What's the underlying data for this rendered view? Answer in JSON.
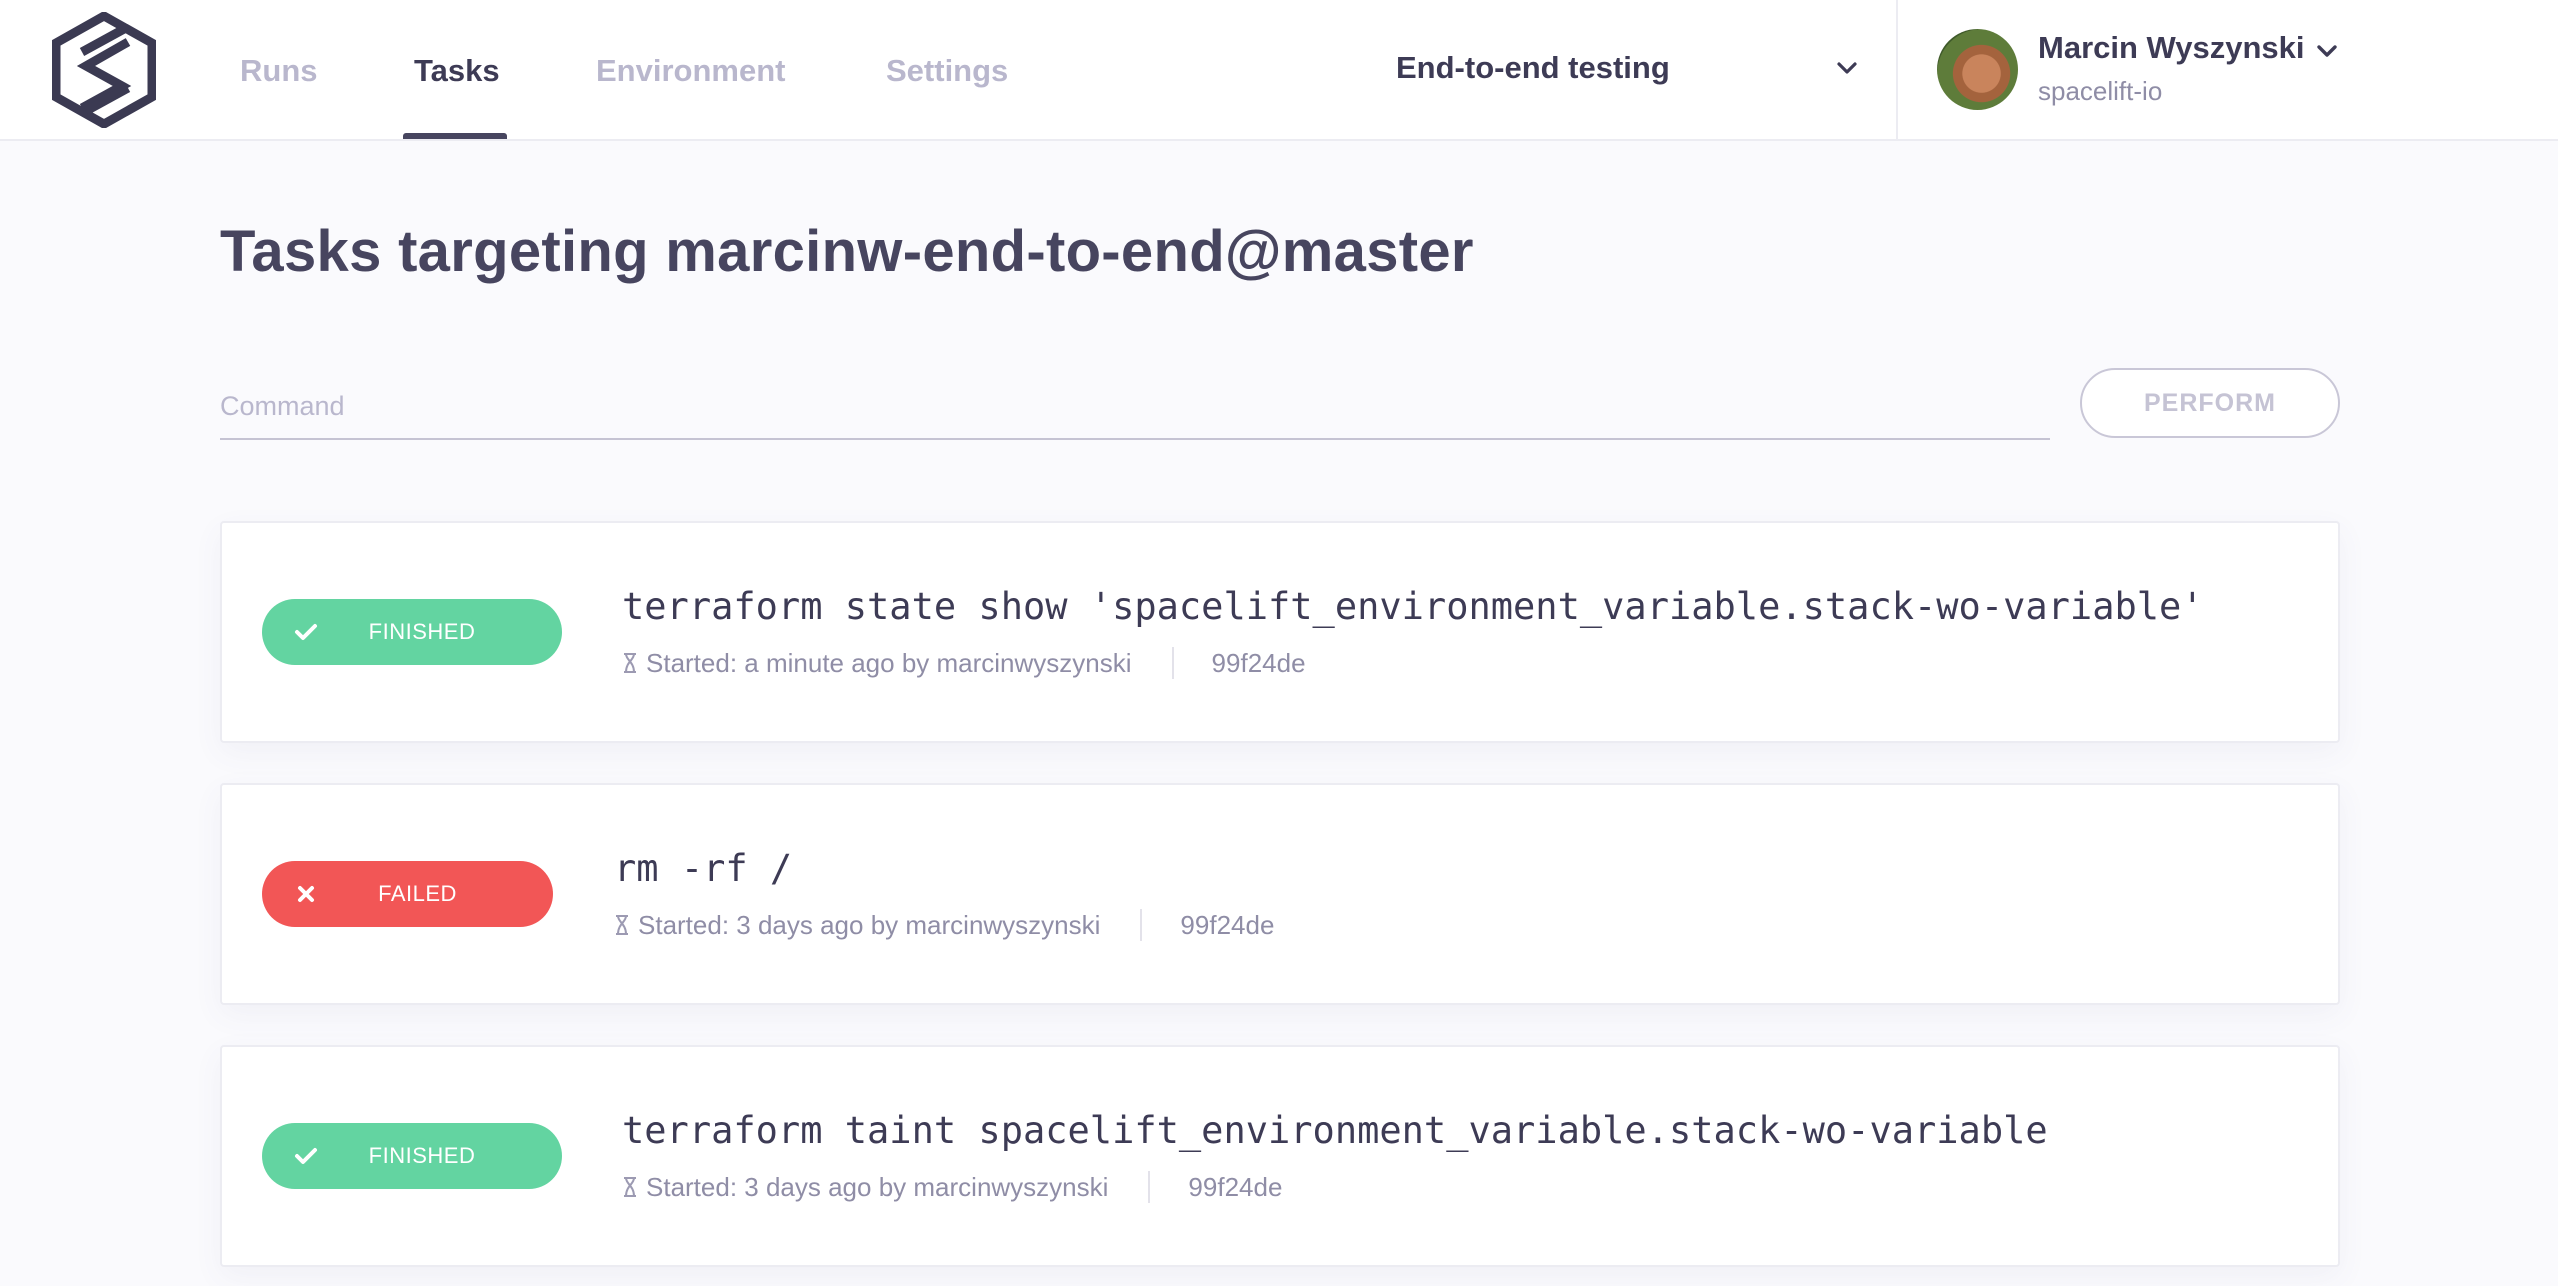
{
  "nav": {
    "tabs": [
      {
        "label": "Runs"
      },
      {
        "label": "Tasks"
      },
      {
        "label": "Environment"
      },
      {
        "label": "Settings"
      }
    ],
    "active_tab": "Tasks"
  },
  "stack_selector": {
    "label": "End-to-end testing"
  },
  "user": {
    "name": "Marcin Wyszynski",
    "org": "spacelift-io"
  },
  "page": {
    "title": "Tasks targeting marcinw-end-to-end@master"
  },
  "command_form": {
    "placeholder": "Command",
    "perform_label": "PERFORM"
  },
  "tasks": [
    {
      "status": "FINISHED",
      "command": "terraform state show 'spacelift_environment_variable.stack-wo-variable'",
      "started": "Started: a minute ago by marcinwyszynski",
      "sha": "99f24de"
    },
    {
      "status": "FAILED",
      "command": "rm -rf /",
      "started": "Started: 3 days ago by marcinwyszynski",
      "sha": "99f24de"
    },
    {
      "status": "FINISHED",
      "command": "terraform taint spacelift_environment_variable.stack-wo-variable",
      "started": "Started: 3 days ago by marcinwyszynski",
      "sha": "99f24de"
    }
  ],
  "colors": {
    "finished": "#63d4a1",
    "failed": "#f25656",
    "text_dark": "#3d3b55",
    "text_muted": "#8f8da6",
    "nav_inactive": "#b9b7cd"
  },
  "icons": [
    "spacelift-logo",
    "chevron-down-icon",
    "check-icon",
    "x-icon",
    "hourglass-icon"
  ]
}
